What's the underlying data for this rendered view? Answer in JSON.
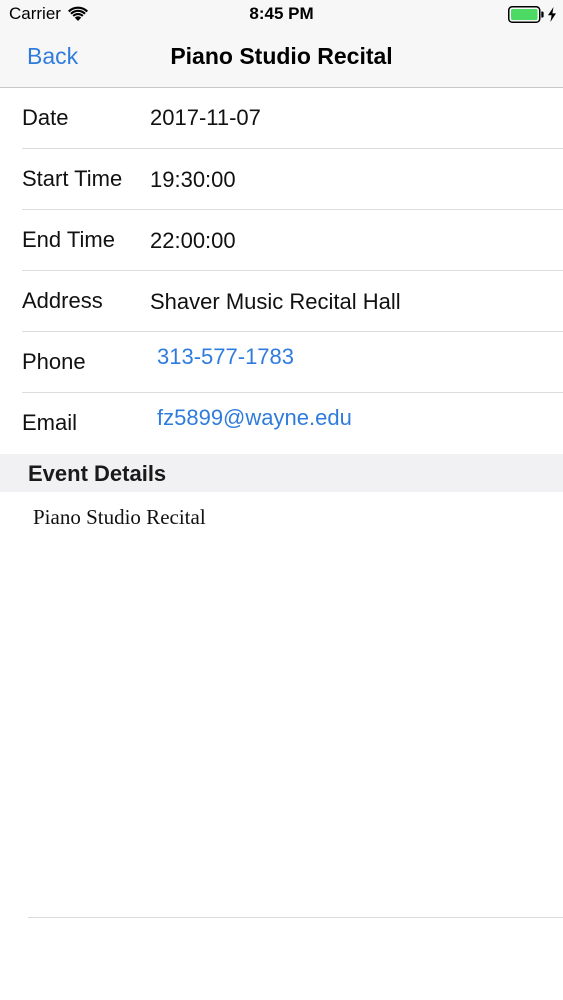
{
  "status_bar": {
    "carrier": "Carrier",
    "time": "8:45 PM",
    "wifi_icon": "wifi-icon",
    "battery_icon": "battery-full-icon",
    "charging_icon": "charging-bolt-icon",
    "battery_color": "#4cd964"
  },
  "nav": {
    "back_label": "Back",
    "title": "Piano Studio Recital",
    "accent_color": "#2f7cdd"
  },
  "rows": [
    {
      "label": "Date",
      "value": "2017-11-07"
    },
    {
      "label": "Start Time",
      "value": "19:30:00"
    },
    {
      "label": "End Time",
      "value": "22:00:00"
    },
    {
      "label": "Address",
      "value": "Shaver Music Recital Hall"
    },
    {
      "label": "Phone",
      "value": "313-577-1783"
    },
    {
      "label": "Email",
      "value": "fz5899@wayne.edu"
    }
  ],
  "section": {
    "header": "Event Details",
    "body": "Piano Studio Recital"
  }
}
